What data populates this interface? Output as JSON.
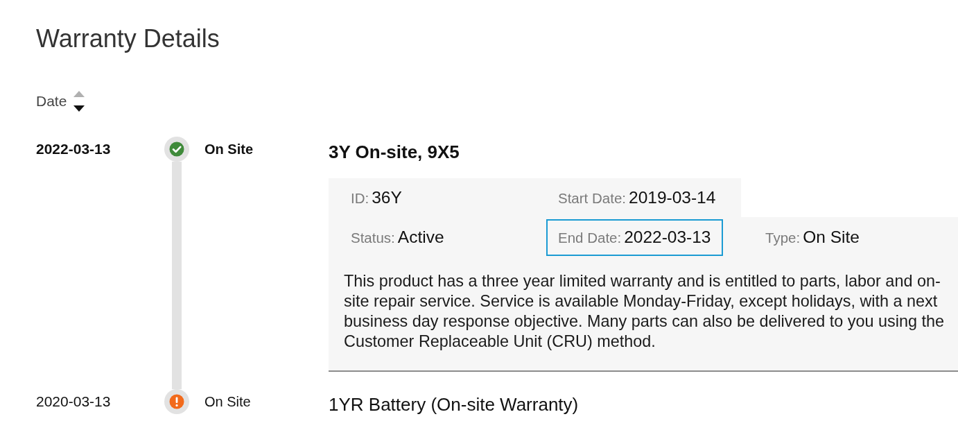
{
  "page": {
    "title": "Warranty Details"
  },
  "sort": {
    "label": "Date",
    "descending": true
  },
  "timeline": [
    {
      "date": "2022-03-13",
      "kind": "active",
      "status": "On Site",
      "title": "3Y On-site, 9X5",
      "expanded": true,
      "details": {
        "field_rows": [
          [
            {
              "label": "ID:",
              "value": "36Y",
              "highlighted": false
            },
            {
              "label": "Start Date:",
              "value": "2019-03-14",
              "highlighted": false
            }
          ],
          [
            {
              "label": "Status:",
              "value": "Active",
              "highlighted": false
            },
            {
              "label": "End Date:",
              "value": "2022-03-13",
              "highlighted": true
            },
            {
              "label": "Type:",
              "value": "On Site",
              "highlighted": false
            }
          ]
        ],
        "description": "This product has a three year limited warranty and is entitled to parts, labor and on-site repair service. Service is available Monday-Friday, except holidays, with a next business day response objective. Many parts can also be delivered to you using the Customer Replaceable Unit (CRU) method."
      }
    },
    {
      "date": "2020-03-13",
      "kind": "warning",
      "status": "On Site",
      "title": "1YR Battery (On-site Warranty)",
      "expanded": false
    }
  ]
}
